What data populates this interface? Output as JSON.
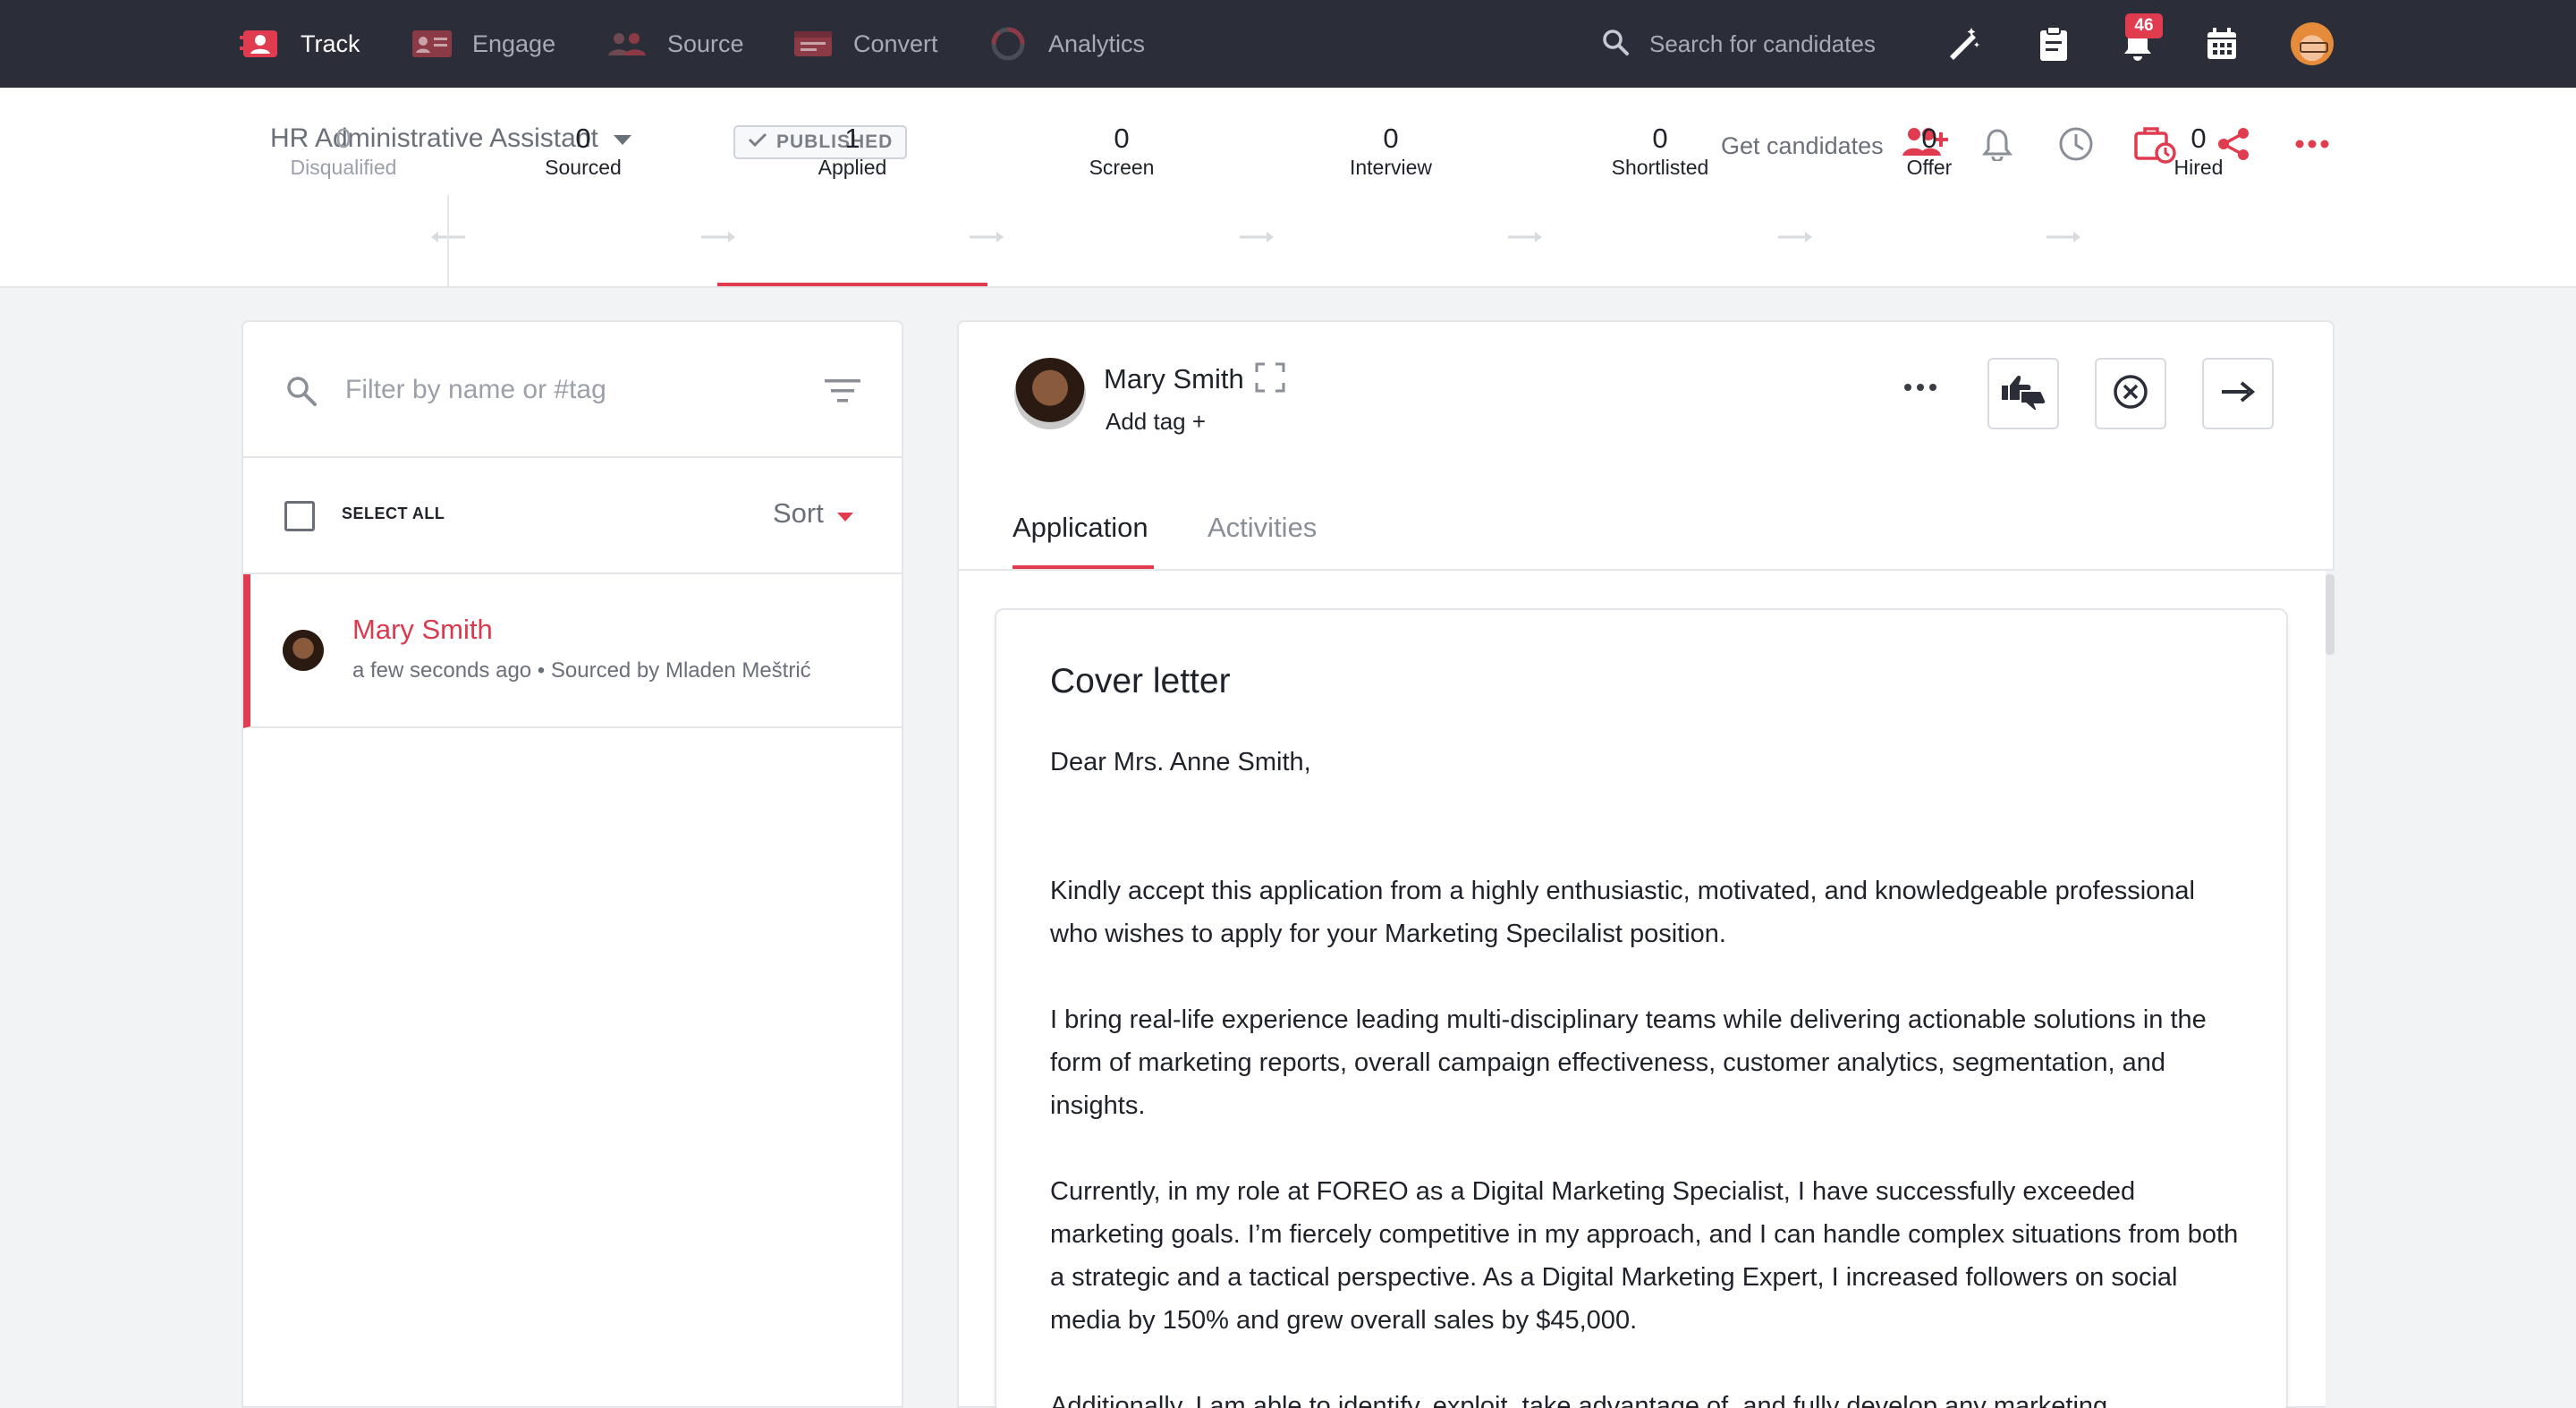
{
  "nav": {
    "items": [
      {
        "label": "Track",
        "icon": "track-icon",
        "active": true
      },
      {
        "label": "Engage",
        "icon": "engage-icon",
        "active": false
      },
      {
        "label": "Source",
        "icon": "source-icon",
        "active": false
      },
      {
        "label": "Convert",
        "icon": "convert-icon",
        "active": false
      },
      {
        "label": "Analytics",
        "icon": "analytics-icon",
        "active": false
      }
    ],
    "search_placeholder": "Search for candidates",
    "notification_count": "46"
  },
  "job": {
    "title": "HR Administrative Assistant",
    "status": "PUBLISHED",
    "get_candidates": "Get candidates"
  },
  "pipeline": {
    "stages": [
      {
        "count": "0",
        "label": "Disqualified"
      },
      {
        "count": "0",
        "label": "Sourced"
      },
      {
        "count": "1",
        "label": "Applied"
      },
      {
        "count": "0",
        "label": "Screen"
      },
      {
        "count": "0",
        "label": "Interview"
      },
      {
        "count": "0",
        "label": "Shortlisted"
      },
      {
        "count": "0",
        "label": "Offer"
      },
      {
        "count": "0",
        "label": "Hired"
      }
    ],
    "active_stage": "Applied"
  },
  "list": {
    "filter_placeholder": "Filter by name or #tag",
    "select_all": "SELECT ALL",
    "sort_label": "Sort",
    "candidates": [
      {
        "name": "Mary Smith",
        "meta": "a few seconds ago • Sourced by Mladen Meštrić"
      }
    ]
  },
  "candidate": {
    "name": "Mary Smith",
    "add_tag": "Add tag +",
    "tabs": [
      "Application",
      "Activities"
    ],
    "active_tab": "Application"
  },
  "cover_letter": {
    "title": "Cover letter",
    "salutation": "Dear Mrs. Anne Smith,",
    "paragraphs": [
      "Kindly accept this application from a highly enthusiastic, motivated, and knowledgeable professional who wishes to apply for your Marketing Specilalist position.",
      "I bring real-life experience leading multi-disciplinary teams while delivering actionable solutions in the form of marketing reports, overall campaign effectiveness, customer analytics, segmentation, and insights.",
      "Currently, in my role at FOREO as a Digital Marketing Specialist, I have successfully exceeded marketing goals. I’m fiercely competitive in my approach, and I can handle complex situations from both a strategic and a tactical perspective. As a Digital Marketing Expert, I increased followers on social media by 150% and grew overall sales by $45,000.",
      "Additionally, I am able to identify, exploit, take advantage of, and fully develop any marketing"
    ]
  },
  "colors": {
    "accent": "#e03b4f",
    "nav_bg": "#2b2e38",
    "page_bg": "#f2f3f5"
  }
}
